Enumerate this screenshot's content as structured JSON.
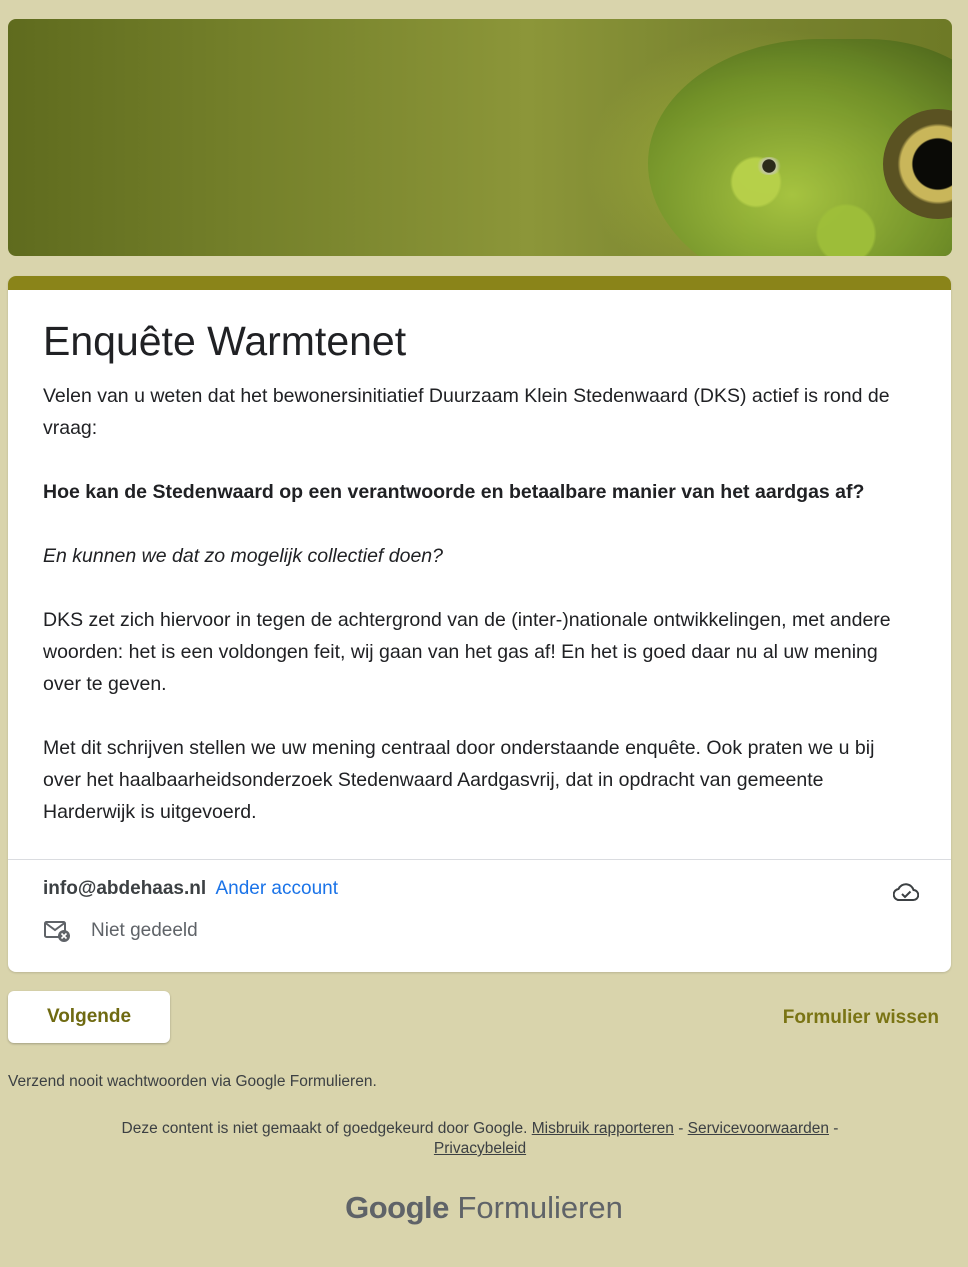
{
  "header": {
    "banner_image": "frog-close-up-green-banner"
  },
  "form": {
    "title": "Enquête Warmtenet",
    "description": [
      "Velen van u weten dat het bewonersinitiatief Duurzaam Klein Stedenwaard (DKS) actief is rond de vraag:",
      "Hoe kan de Stedenwaard op een verantwoorde en betaalbare manier van het aardgas af?",
      "En kunnen we dat zo mogelijk collectief doen?",
      "DKS zet zich hiervoor in tegen de achtergrond van de (inter-)nationale ontwikkelingen, met andere woorden: het is een voldongen feit, wij gaan van het gas af!  En het is goed daar nu al uw mening over te geven.",
      "Met dit schrijven stellen we uw mening centraal door onderstaande enquête. Ook praten we u bij over het haalbaarheidsonderzoek Stedenwaard Aardgasvrij, dat in opdracht van gemeente Harderwijk is uitgevoerd."
    ]
  },
  "account": {
    "email": "info@abdehaas.nl",
    "switch_label": "Ander account",
    "sharing_status": "Niet gedeeld"
  },
  "actions": {
    "next_label": "Volgende",
    "clear_label": "Formulier wissen"
  },
  "footer": {
    "warning": "Verzend nooit wachtwoorden via Google Formulieren.",
    "disclaimer_text": "Deze content is niet gemaakt of goedgekeurd door Google.",
    "report_link": "Misbruik rapporteren",
    "separator": "-",
    "terms_link": "Servicevoorwaarden",
    "privacy_link": "Privacybeleid",
    "brand_google": "Google",
    "brand_product": "Formulieren"
  },
  "colors": {
    "page_bg": "#d9d4ac",
    "accent": "#8a8419",
    "link": "#1a73e8"
  }
}
